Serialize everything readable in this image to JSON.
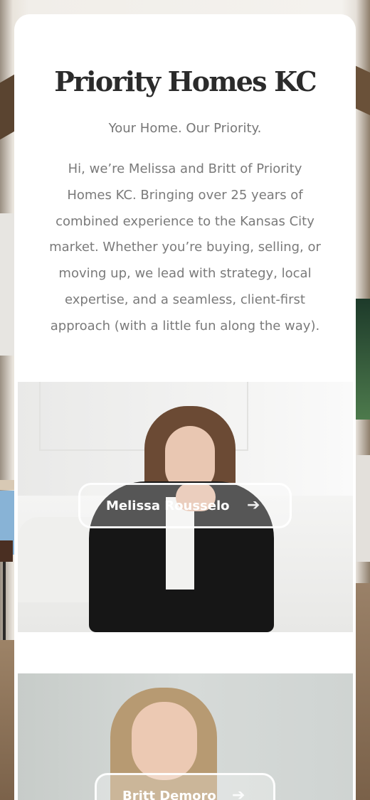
{
  "header": {
    "title": "Priority Homes KC",
    "tagline": "Your Home. Our Priority.",
    "intro": "Hi, we’re Melissa and Britt of Priority Homes KC. Bringing over 25 years of combined experience to the Kansas City market. Whether you’re buying, selling, or moving up, we lead with strategy, local expertise, and a seamless, client-first approach (with a little fun along the way)."
  },
  "agents": [
    {
      "name": "Melissa Rousselo",
      "icon": "arrow-right-icon"
    },
    {
      "name": "Britt Demoro",
      "icon": "arrow-right-icon"
    }
  ],
  "colors": {
    "card": "#ffffff",
    "title": "#2b2b2b",
    "body_text": "#7a7a7a"
  }
}
